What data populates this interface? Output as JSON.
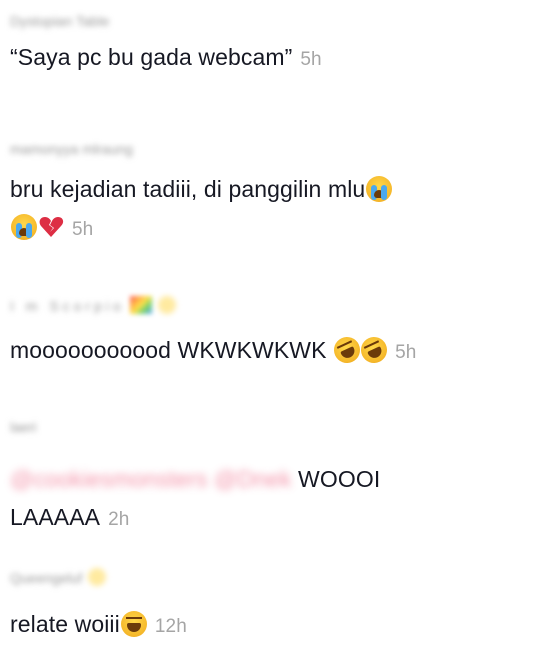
{
  "comments": [
    {
      "username": "Dystopian Table",
      "text": "“Saya pc bu gada webcam”",
      "time": "5h"
    },
    {
      "username": "mamonyya mlraung",
      "text": "bru kejadian tadiii, di panggilin mlu",
      "time": "5h",
      "emojis": [
        "loudly-crying-face",
        "loudly-crying-face",
        "broken-heart"
      ]
    },
    {
      "username": "I m Scorpio",
      "text": "mooooooooood WKWKWKWK",
      "time": "5h",
      "emojis": [
        "rolling-on-floor-laughing",
        "rolling-on-floor-laughing"
      ]
    },
    {
      "username": "laeri",
      "mention": "@cookiesmonsters @Dnek",
      "text_line1": " WOOOI",
      "text_line2": "LAAAAA",
      "time": "2h"
    },
    {
      "username": "Queengeluf",
      "text": "relate woiii",
      "time": "12h",
      "emojis": [
        "crying-laughing-face"
      ]
    }
  ],
  "colors": {
    "text": "#161823",
    "time": "#a5a5a5",
    "username": "#9a9a9a",
    "mention": "#f06f8c"
  }
}
